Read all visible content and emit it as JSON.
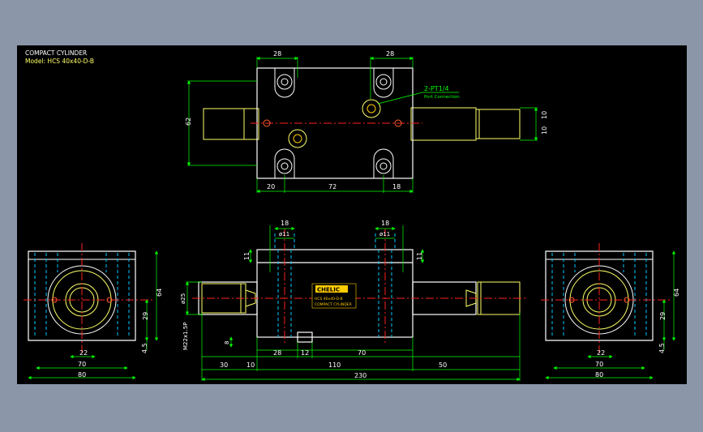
{
  "drawing": {
    "title": "COMPACT CYLINDER",
    "model": "Model: HCS 40x40-D-B",
    "colors": {
      "sheet": "#000000",
      "frame": "#8b96a8",
      "outline": "#ffffff",
      "dimension": "#00ff00",
      "hidden": "#00c8ff",
      "centerline": "#ff2020",
      "rod": "#ffff66",
      "label": "#ffcc00"
    }
  },
  "top_view": {
    "dim_left_hole_spacing": "28",
    "dim_right_hole_spacing": "28",
    "port_label": "2-PT1/4",
    "port_sublabel": "Port Connection",
    "dim_height": "62",
    "dim_rod_1": "10",
    "dim_rod_2": "10",
    "dim_bottom_left": "20",
    "dim_bottom_mid": "72",
    "dim_bottom_right": "18"
  },
  "front_view": {
    "dim_port_left_width": "18",
    "dim_port_right_width": "18",
    "dim_port_left_dia": "ø11",
    "dim_port_right_dia": "ø11",
    "dim_port_left_depth": "11",
    "dim_port_right_depth": "11",
    "dim_rod_dia": "ø25",
    "dim_thread": "M22x1.5P",
    "dim_small_height": "8",
    "dim_b_10": "10",
    "dim_b_28": "28",
    "dim_b_12": "12",
    "dim_b_70": "70",
    "dim_b_30": "30",
    "dim_b_110": "110",
    "dim_b_50": "50",
    "dim_total": "230",
    "nameplate_brand": "CHELIC",
    "nameplate_model": "HCS 40x40-D-B",
    "nameplate_desc": "COMPACT CYLINDER"
  },
  "side_view_left": {
    "dim_height": "64",
    "dim_center": "29",
    "dim_base": "4.5",
    "dim_inner": "22",
    "dim_mid": "70",
    "dim_width": "80"
  },
  "side_view_right": {
    "dim_height": "64",
    "dim_center": "29",
    "dim_base": "4.5",
    "dim_inner": "22",
    "dim_mid": "70",
    "dim_width": "80"
  }
}
